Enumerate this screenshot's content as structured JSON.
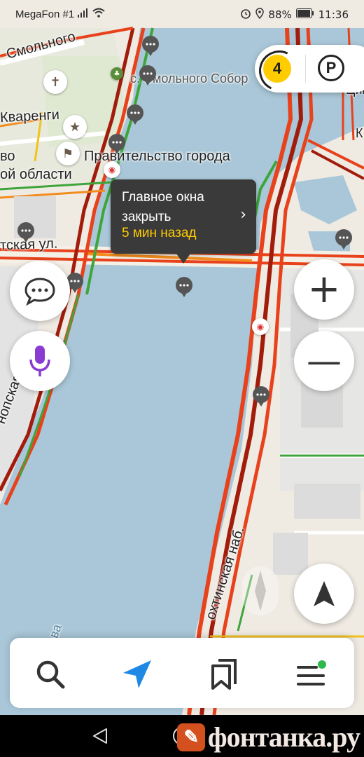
{
  "statusbar": {
    "carrier": "MegaFon #1",
    "battery": "88%",
    "time": "11:36"
  },
  "map": {
    "labels": {
      "smolnogo_street": "Смольного",
      "smolny_cathedral": "с. Смольного Собор",
      "kvarengi": "Кваренги",
      "city_government": "Правительство города",
      "region_part_1": "во",
      "region_part_2": "ой области",
      "street_fragment": "тская ул.",
      "sinopskaya": "нопская наб.",
      "okhtinskaya": "охтинская наб.",
      "cim": "Цим",
      "k_fragment": "К",
      "b_fragment": "Б",
      "va_fragment": "ва"
    }
  },
  "traffic": {
    "level": "4"
  },
  "tooltip": {
    "title": "Главное окна закрыть",
    "time_ago": "5 мин назад"
  },
  "buttons": {
    "zoom_in": "+",
    "zoom_out": "—"
  },
  "watermark": {
    "text": "фонтанка.ру"
  },
  "icons": {
    "chat": "chat-icon",
    "voice": "microphone-icon",
    "search": "search-icon",
    "navigate": "navigation-arrow-icon",
    "bookmarks": "bookmarks-icon",
    "menu": "menu-icon",
    "parking": "parking-icon",
    "location": "location-arrow-icon"
  },
  "colors": {
    "river": "#a9c7d8",
    "traffic_red": "#e8421c",
    "traffic_dark": "#a21c0c",
    "traffic_orange": "#f28c1d",
    "traffic_green": "#3da53a",
    "badge_yellow": "#ffcc00",
    "voice_purple": "#8a3bd1",
    "nav_blue": "#1e88e5"
  }
}
